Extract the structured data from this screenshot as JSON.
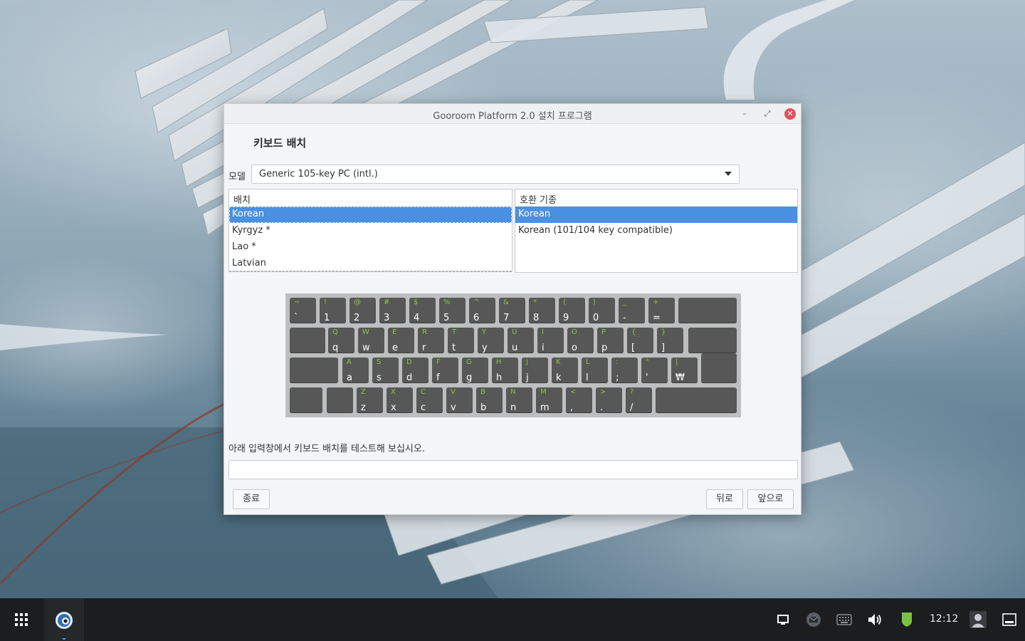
{
  "window": {
    "title": "Gooroom Platform 2.0 설치 프로그램",
    "minimize_glyph": "–",
    "maximize_glyph": "⤢",
    "close_glyph": "✕"
  },
  "page": {
    "heading": "키보드 배치"
  },
  "model": {
    "label": "모델",
    "value": "Generic 105-key PC (intl.)"
  },
  "layout_list": {
    "header": "배치",
    "items": [
      "Korean",
      "Kyrgyz *",
      "Lao *",
      "Latvian"
    ],
    "selected_index": 0
  },
  "variant_list": {
    "header": "호환 기종",
    "items": [
      "Korean",
      "Korean (101/104 key compatible)"
    ],
    "selected_index": 0
  },
  "keyboard": {
    "row1": [
      {
        "up": "~",
        "lo": "`"
      },
      {
        "up": "!",
        "lo": "1"
      },
      {
        "up": "@",
        "lo": "2"
      },
      {
        "up": "#",
        "lo": "3"
      },
      {
        "up": "$",
        "lo": "4"
      },
      {
        "up": "%",
        "lo": "5"
      },
      {
        "up": "^",
        "lo": "6"
      },
      {
        "up": "&",
        "lo": "7"
      },
      {
        "up": "*",
        "lo": "8"
      },
      {
        "up": "(",
        "lo": "9"
      },
      {
        "up": ")",
        "lo": "0"
      },
      {
        "up": "_",
        "lo": "-"
      },
      {
        "up": "+",
        "lo": "="
      }
    ],
    "row2": [
      {
        "up": "Q",
        "lo": "q"
      },
      {
        "up": "W",
        "lo": "w"
      },
      {
        "up": "E",
        "lo": "e"
      },
      {
        "up": "R",
        "lo": "r"
      },
      {
        "up": "T",
        "lo": "t"
      },
      {
        "up": "Y",
        "lo": "y"
      },
      {
        "up": "U",
        "lo": "u"
      },
      {
        "up": "I",
        "lo": "i"
      },
      {
        "up": "O",
        "lo": "o"
      },
      {
        "up": "P",
        "lo": "p"
      },
      {
        "up": "{",
        "lo": "["
      },
      {
        "up": "}",
        "lo": "]"
      }
    ],
    "row3": [
      {
        "up": "A",
        "lo": "a"
      },
      {
        "up": "S",
        "lo": "s"
      },
      {
        "up": "D",
        "lo": "d"
      },
      {
        "up": "F",
        "lo": "f"
      },
      {
        "up": "G",
        "lo": "g"
      },
      {
        "up": "H",
        "lo": "h"
      },
      {
        "up": "J",
        "lo": "j"
      },
      {
        "up": "K",
        "lo": "k"
      },
      {
        "up": "L",
        "lo": "l"
      },
      {
        "up": ":",
        "lo": ";"
      },
      {
        "up": "\"",
        "lo": "'"
      },
      {
        "up": "|",
        "lo": "₩"
      }
    ],
    "row4": [
      {
        "up": "Z",
        "lo": "z"
      },
      {
        "up": "X",
        "lo": "x"
      },
      {
        "up": "C",
        "lo": "c"
      },
      {
        "up": "V",
        "lo": "v"
      },
      {
        "up": "B",
        "lo": "b"
      },
      {
        "up": "N",
        "lo": "n"
      },
      {
        "up": "M",
        "lo": "m"
      },
      {
        "up": "<",
        "lo": ","
      },
      {
        "up": ">",
        "lo": "."
      },
      {
        "up": "?",
        "lo": "/"
      }
    ]
  },
  "test": {
    "label": "아래 입력창에서 키보드 배치를 테스트해 보십시오.",
    "value": ""
  },
  "buttons": {
    "quit": "종료",
    "back": "뒤로",
    "next": "앞으로"
  },
  "taskbar": {
    "clock": "12:12",
    "icons": [
      "apps-grid-icon",
      "browser-icon",
      "window-icon",
      "mail-icon",
      "keyboard-icon",
      "volume-icon",
      "security-shield-icon",
      "user-icon",
      "show-desktop-icon"
    ]
  },
  "colors": {
    "selection": "#4a90e2",
    "key_face": "#575757",
    "key_shift_label": "#8cc63f",
    "close_button": "#e0505a",
    "shield": "#7ac143"
  }
}
